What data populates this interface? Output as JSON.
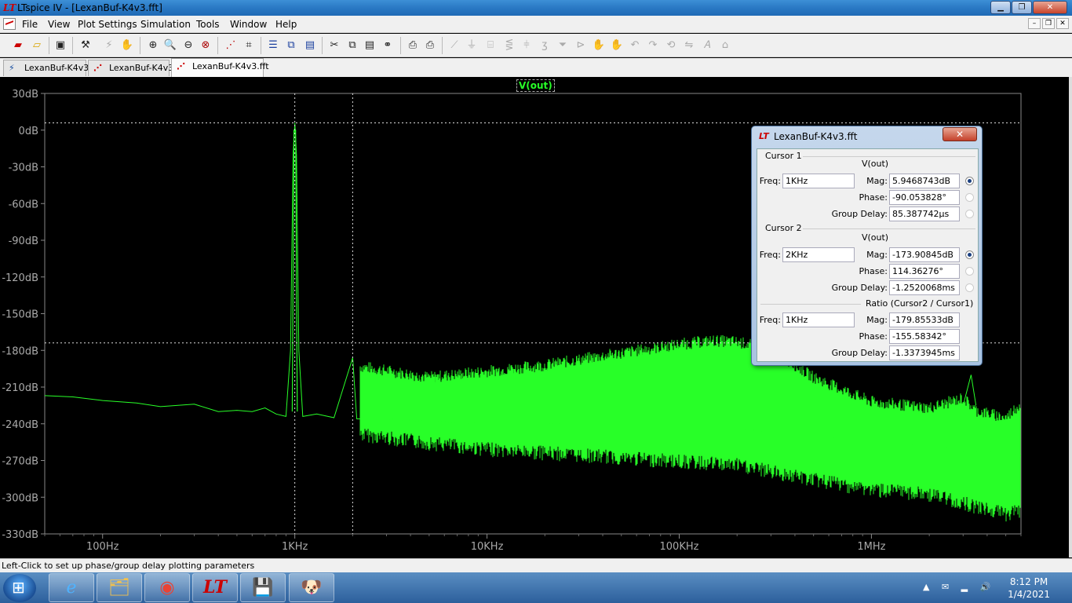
{
  "window": {
    "app_icon": "LT",
    "title": "LTspice IV - [LexanBuf-K4v3.fft]",
    "controls": [
      "minimize-icon",
      "restore-icon",
      "close-icon"
    ]
  },
  "menu": {
    "items": [
      "File",
      "View",
      "Plot Settings",
      "Simulation",
      "Tools",
      "Window",
      "Help"
    ]
  },
  "toolbar": {
    "icons": [
      "new-schematic-icon",
      "open-icon",
      "save-icon",
      "control-panel-icon",
      "run-icon",
      "halt-icon",
      "zoom-in-icon",
      "zoom-area-icon",
      "zoom-out-icon",
      "zoom-cancel-icon",
      "autorange-icon",
      "probe-icon",
      "tile-horizontal-icon",
      "cascade-icon",
      "tile-vertical-icon",
      "cut-icon",
      "copy-icon",
      "paste-icon",
      "find-icon",
      "print-preview-icon",
      "print-icon",
      "wire-icon",
      "ground-icon",
      "label-icon",
      "resistor-icon",
      "capacitor-icon",
      "inductor-icon",
      "diode-icon",
      "component-icon",
      "move-icon",
      "drag-icon",
      "undo-icon",
      "redo-icon",
      "rotate-icon",
      "mirror-icon",
      "text-icon",
      "spice-directive-icon"
    ]
  },
  "tabs": [
    {
      "label": "LexanBuf-K4v3",
      "icon": "schematic-icon"
    },
    {
      "label": "LexanBuf-K4v3",
      "icon": "waveform-icon"
    },
    {
      "label": "LexanBuf-K4v3.fft",
      "icon": "fft-icon"
    }
  ],
  "plot": {
    "trace_label": "V(out)",
    "trace_color": "#28ff28",
    "background": "#000000"
  },
  "chart_data": {
    "type": "line",
    "title": "",
    "xlabel": "",
    "ylabel": "",
    "x_scale": "log",
    "xlim": [
      50,
      6000000
    ],
    "ylim": [
      -330,
      30
    ],
    "x_ticks": [
      "100Hz",
      "1KHz",
      "10KHz",
      "100KHz",
      "1MHz"
    ],
    "y_ticks": [
      "30dB",
      "0dB",
      "-30dB",
      "-60dB",
      "-90dB",
      "-120dB",
      "-150dB",
      "-180dB",
      "-210dB",
      "-240dB",
      "-270dB",
      "-300dB",
      "-330dB"
    ],
    "cursors": {
      "cursor1": {
        "freq": 1000,
        "mag_db": 5.9468743
      },
      "cursor2": {
        "freq": 2000,
        "mag_db": -173.90845
      }
    },
    "series": [
      {
        "name": "V(out)",
        "color": "#28ff28",
        "points": [
          [
            50,
            -217
          ],
          [
            70,
            -218
          ],
          [
            100,
            -221
          ],
          [
            150,
            -223
          ],
          [
            200,
            -226
          ],
          [
            300,
            -224
          ],
          [
            400,
            -230
          ],
          [
            500,
            -229
          ],
          [
            600,
            -230
          ],
          [
            700,
            -227
          ],
          [
            800,
            -232
          ],
          [
            900,
            -234
          ],
          [
            950,
            -180
          ],
          [
            980,
            -20
          ],
          [
            1000,
            5.95
          ],
          [
            1020,
            -20
          ],
          [
            1050,
            -180
          ],
          [
            1100,
            -234
          ],
          [
            1300,
            -232
          ],
          [
            1600,
            -235
          ],
          [
            2000,
            -186
          ],
          [
            2100,
            -236
          ],
          [
            3000,
            -236
          ],
          [
            5000,
            -238
          ],
          [
            10000,
            -240
          ],
          [
            20000,
            -240
          ],
          [
            50000,
            -242
          ],
          [
            100000,
            -243
          ],
          [
            200000,
            -244
          ],
          [
            500000,
            -250
          ],
          [
            1000000,
            -254
          ],
          [
            2000000,
            -258
          ],
          [
            3000000,
            -262
          ],
          [
            5000000,
            -264
          ],
          [
            6000000,
            -266
          ]
        ],
        "upper_envelope": [
          [
            2000,
            -195
          ],
          [
            5000,
            -205
          ],
          [
            10000,
            -200
          ],
          [
            20000,
            -195
          ],
          [
            50000,
            -185
          ],
          [
            100000,
            -178
          ],
          [
            150000,
            -175
          ],
          [
            200000,
            -176
          ],
          [
            300000,
            -182
          ],
          [
            500000,
            -205
          ],
          [
            1000000,
            -225
          ],
          [
            2000000,
            -230
          ],
          [
            3000000,
            -222
          ],
          [
            3500000,
            -232
          ],
          [
            5000000,
            -238
          ],
          [
            6000000,
            -226
          ]
        ],
        "lower_envelope": [
          [
            2000,
            -242
          ],
          [
            5000,
            -250
          ],
          [
            10000,
            -255
          ],
          [
            20000,
            -258
          ],
          [
            50000,
            -262
          ],
          [
            100000,
            -265
          ],
          [
            200000,
            -268
          ],
          [
            500000,
            -280
          ],
          [
            1000000,
            -288
          ],
          [
            2000000,
            -292
          ],
          [
            5000000,
            -308
          ],
          [
            6000000,
            -305
          ]
        ]
      }
    ]
  },
  "cursor_dialog": {
    "icon": "LT",
    "title": "LexanBuf-K4v3.fft",
    "cursor1": {
      "group": "Cursor 1",
      "signal": "V(out)",
      "freq_label": "Freq:",
      "freq": "1KHz",
      "mag_label": "Mag:",
      "mag": "5.9468743dB",
      "phase_label": "Phase:",
      "phase": "-90.053828°",
      "gd_label": "Group Delay:",
      "gd": "85.387742µs"
    },
    "cursor2": {
      "group": "Cursor 2",
      "signal": "V(out)",
      "freq_label": "Freq:",
      "freq": "2KHz",
      "mag_label": "Mag:",
      "mag": "-173.90845dB",
      "phase_label": "Phase:",
      "phase": "114.36276°",
      "gd_label": "Group Delay:",
      "gd": "-1.2520068ms"
    },
    "ratio": {
      "group": "Ratio (Cursor2 / Cursor1)",
      "freq_label": "Freq:",
      "freq": "1KHz",
      "mag_label": "Mag:",
      "mag": "-179.85533dB",
      "phase_label": "Phase:",
      "phase": "-155.58342°",
      "gd_label": "Group Delay:",
      "gd": "-1.3373945ms"
    }
  },
  "status": {
    "text": "Left-Click to set up phase/group delay plotting parameters"
  },
  "taskbar": {
    "apps": [
      "internet-explorer-icon",
      "file-explorer-icon",
      "chrome-icon",
      "ltspice-icon",
      "floppy-icon",
      "gimp-icon"
    ],
    "time": "8:12 PM",
    "date": "1/4/2021"
  }
}
